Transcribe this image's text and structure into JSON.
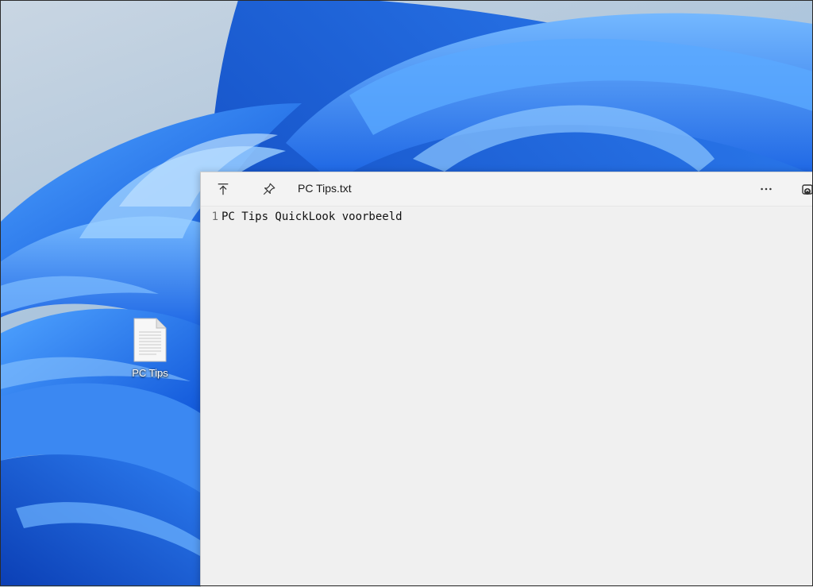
{
  "desktop": {
    "icons": [
      {
        "label": "PC Tips",
        "icon": "text-file-icon"
      }
    ]
  },
  "quicklook": {
    "title": "PC Tips.txt",
    "toolbar": {
      "open_with_icon": "open-with-icon",
      "pin_icon": "pin-icon",
      "more_icon": "more-options-icon"
    },
    "content": {
      "lines": [
        {
          "number": "1",
          "text": "PC Tips QuickLook voorbeeld"
        }
      ]
    }
  },
  "colors": {
    "wallpaper_blue": "#1f6fe8",
    "wallpaper_light": "#c9d6e3",
    "window_bg": "#f0f0f0",
    "titlebar_bg": "#f3f3f3"
  }
}
